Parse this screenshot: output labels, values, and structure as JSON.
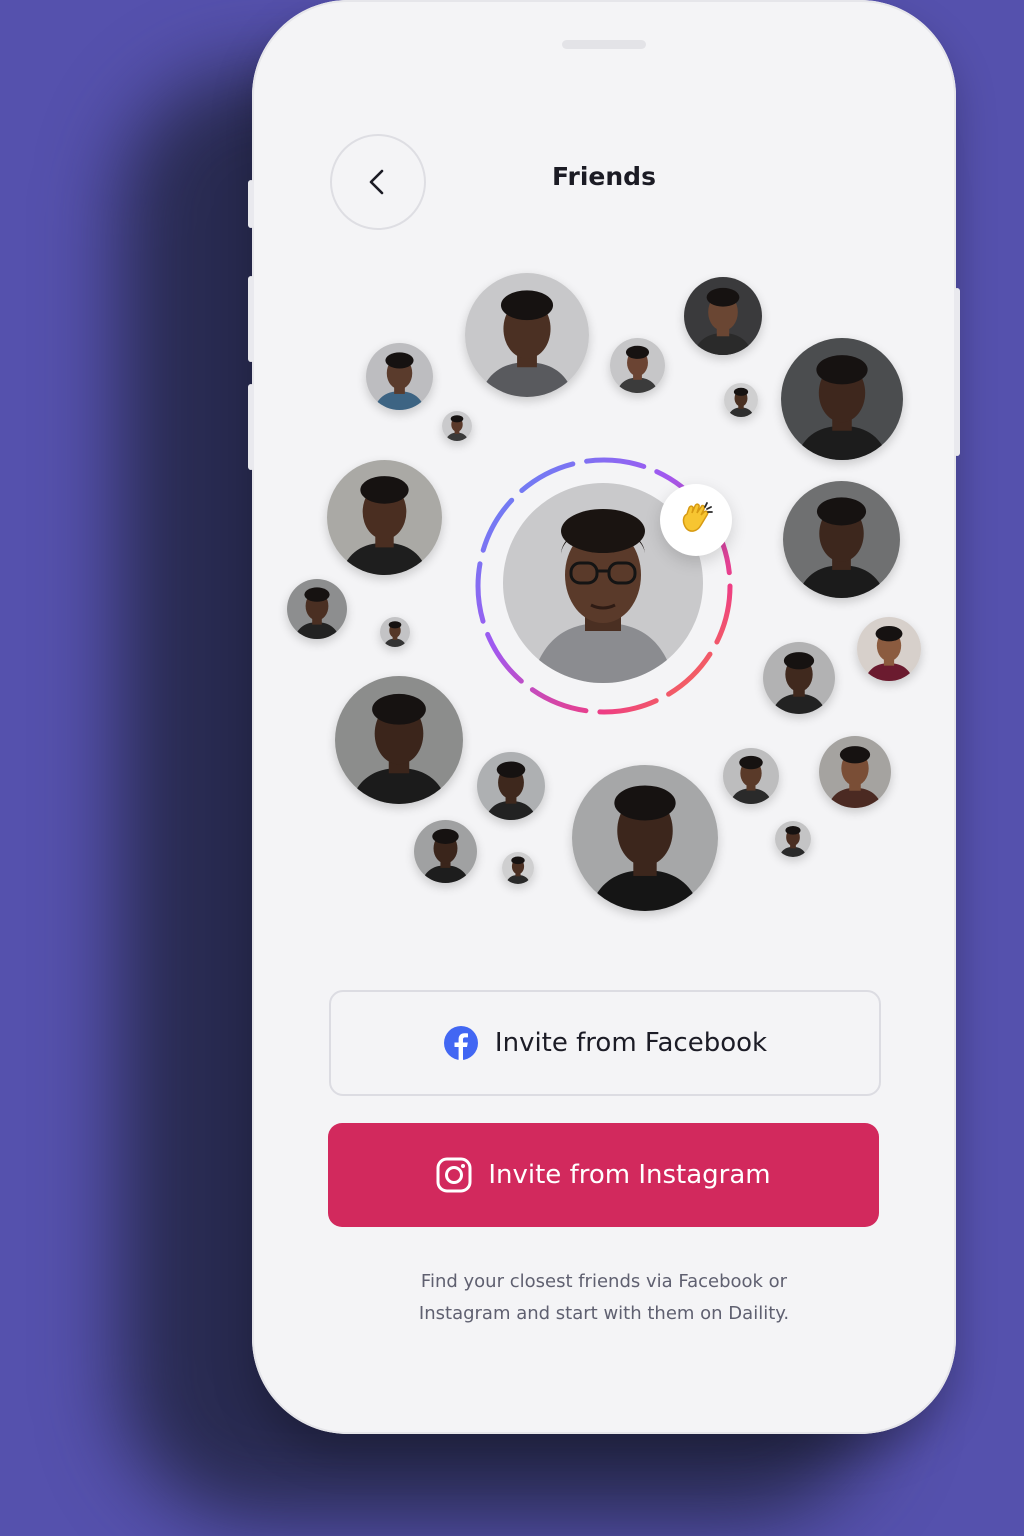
{
  "screen": {
    "title": "Friends",
    "accent_color": "#d2295d",
    "background_color": "#5551ad"
  },
  "navigation": {
    "back_icon": "chevron-left-icon"
  },
  "featured_user": {
    "badge_icon": "waving-hand-icon",
    "badge_emoji": "👋"
  },
  "actions": {
    "facebook": {
      "label": "Invite from Facebook",
      "icon": "facebook-icon",
      "color": "#4267f3"
    },
    "instagram": {
      "label": "Invite from Instagram",
      "icon": "instagram-icon",
      "color": "#d2295d"
    }
  },
  "helper_text": {
    "line1": "Find your closest friends via Facebook or",
    "line2": "Instagram and start with them on Daility."
  }
}
